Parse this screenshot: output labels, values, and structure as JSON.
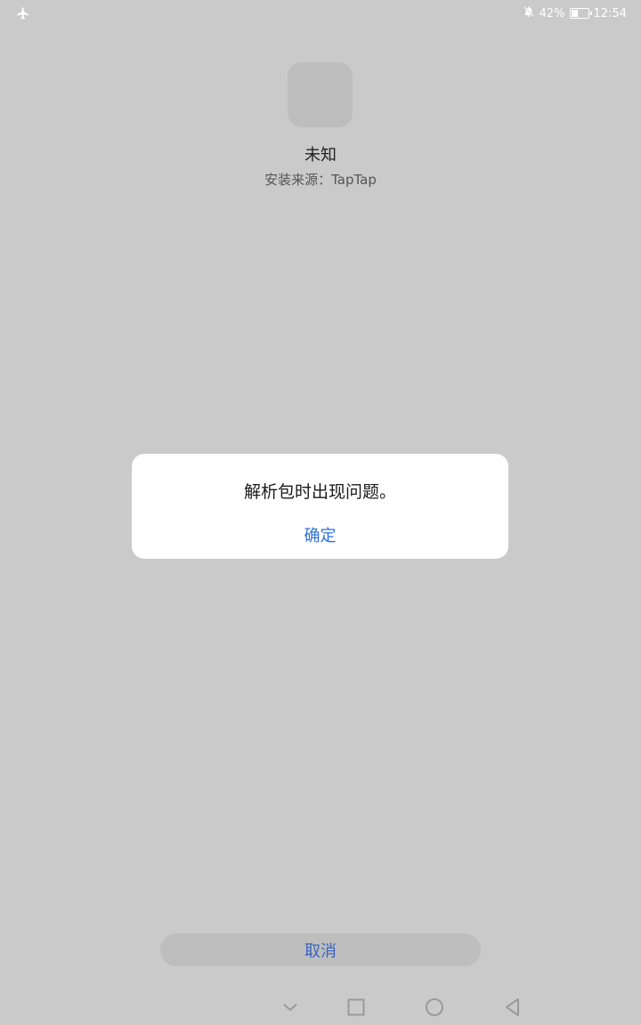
{
  "status_bar": {
    "battery_text": "42%",
    "time": "12:54",
    "icons": [
      "airplane-mode-icon",
      "notifications-off-icon",
      "battery-icon"
    ],
    "battery_level": 0.42
  },
  "app": {
    "name": "未知",
    "install_source": "安装来源：TapTap"
  },
  "dialog": {
    "message": "解析包时出现问题。",
    "confirm_label": "确定"
  },
  "footer": {
    "cancel_label": "取消"
  },
  "nav_bar": {
    "icons": [
      "hide-keyboard-icon",
      "recents-icon",
      "home-icon",
      "back-icon"
    ]
  },
  "colors": {
    "background": "#cacaca",
    "dialog_bg": "#ffffff",
    "accent": "#2b6fd9"
  }
}
